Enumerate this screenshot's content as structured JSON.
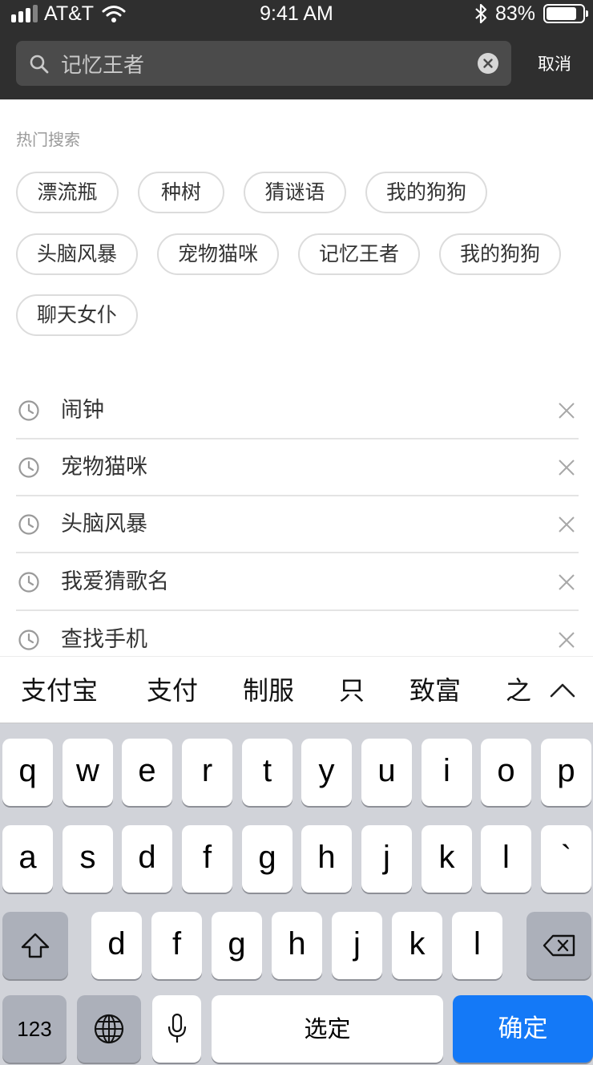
{
  "status_bar": {
    "carrier": "AT&T",
    "time": "9:41 AM",
    "battery": "83%",
    "battery_level": 0.83
  },
  "search": {
    "value": "记忆王者",
    "cancel_label": "取消"
  },
  "hot_search": {
    "title": "热门搜索",
    "tags": [
      "漂流瓶",
      "种树",
      "猜谜语",
      "我的狗狗",
      "头脑风暴",
      "宠物猫咪",
      "记忆王者",
      "我的狗狗",
      "聊天女仆"
    ]
  },
  "history": {
    "items": [
      "闹钟",
      "宠物猫咪",
      "头脑风暴",
      "我爱猜歌名",
      "查找手机"
    ]
  },
  "candidates": [
    "支付宝",
    "支付",
    "制服",
    "只",
    "致富",
    "之"
  ],
  "keyboard": {
    "row1": [
      "q",
      "w",
      "e",
      "r",
      "t",
      "y",
      "u",
      "i",
      "o",
      "p"
    ],
    "row2": [
      "a",
      "s",
      "d",
      "f",
      "g",
      "h",
      "j",
      "k",
      "l",
      "`"
    ],
    "row3": [
      "d",
      "f",
      "g",
      "h",
      "j",
      "k",
      "l"
    ],
    "numbers_label": "123",
    "space_label": "选定",
    "return_label": "确定"
  },
  "colors": {
    "header_bg": "#2f2f2f",
    "accent": "#1479f7",
    "keyboard_bg": "#d1d3d9"
  }
}
